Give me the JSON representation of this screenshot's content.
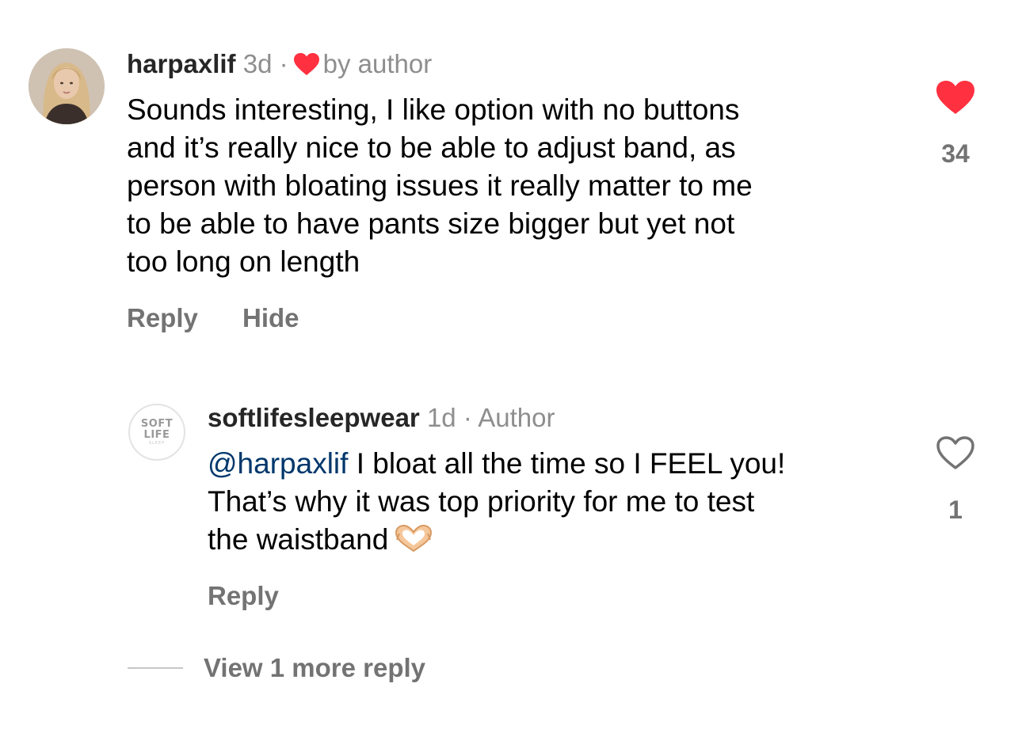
{
  "comments": [
    {
      "username": "harpaxlif",
      "time": "3d",
      "separator": "·",
      "liked_by_author_label": "by author",
      "text": "Sounds interesting, I like option with no buttons\nand it’s really nice to be able to adjust band, as\nperson with bloating issues it really matter to me\nto be able to have pants size bigger but yet not\ntoo long on length",
      "reply_label": "Reply",
      "hide_label": "Hide",
      "like_count": "34",
      "liked": true,
      "like_icon": "heart-filled-icon"
    }
  ],
  "replies": [
    {
      "username": "softlifesleepwear",
      "time": "1d",
      "separator": "·",
      "author_badge": "Author",
      "avatar_logo_line1": "SOFT",
      "avatar_logo_line2": "LIFE",
      "avatar_logo_line3": "SLEEP",
      "mention": "@harpaxlif",
      "text": " I bloat all the time so I FEEL you!\nThat’s why it was top priority for me to test\nthe waistband",
      "emoji": "heart-hands-emoji",
      "reply_label": "Reply",
      "like_count": "1",
      "liked": false,
      "like_icon": "heart-outline-icon"
    }
  ],
  "view_more_label": "View 1 more reply",
  "colors": {
    "heart_red": "#ff3040",
    "muted_text": "#737373",
    "meta_text": "#8e8e8e",
    "mention_blue": "#00376b"
  }
}
